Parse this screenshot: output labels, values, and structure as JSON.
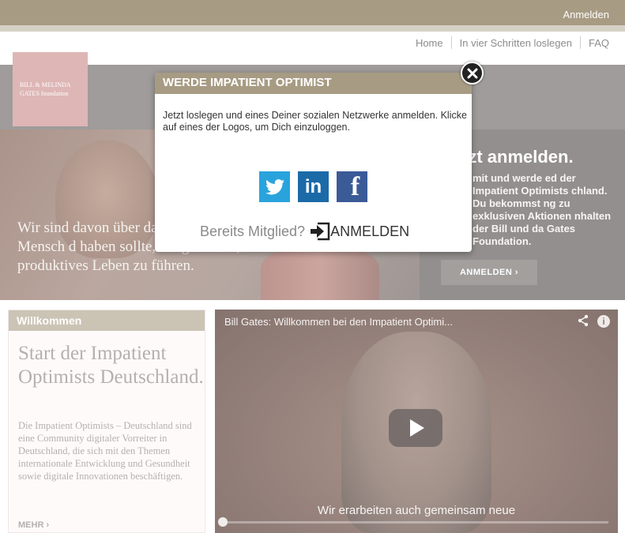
{
  "topbar": {
    "login_label": "Anmelden"
  },
  "nav": {
    "items": [
      "Home",
      "In vier Schritten loslegen",
      "FAQ"
    ]
  },
  "logo": {
    "line1": "BILL & MELINDA",
    "line2": "GATES foundation"
  },
  "hero": {
    "tagline": "Wir sind davon über dass jeder Mensch d haben sollte, ein gesundes, produktives Leben zu führen.",
    "panel_title": "tzt anmelden.",
    "panel_text": "mit und werde ed der Impatient Optimists chland. Du bekommst ng zu exklusiven Aktionen nhalten der Bill und da Gates Foundation.",
    "panel_button": "ANMELDEN ›"
  },
  "welcome": {
    "header": "Willkommen",
    "title": "Start der Impatient Optimists Deutschland.",
    "text": "Die Impatient Optimists – Deutschland sind eine Community digitaler Vorreiter in Deutschland, die sich mit den Themen internationale Entwicklung und Gesundheit sowie digitale Innovationen beschäftigen.",
    "more": "MEHR ›"
  },
  "video": {
    "title": "Bill Gates: Willkommen bei den Impatient Optimi...",
    "caption": "Wir erarbeiten auch gemeinsam neue",
    "progress": 0.0
  },
  "modal": {
    "title": "WERDE IMPATIENT OPTIMIST",
    "text": "Jetzt loslegen und eines Deiner sozialen Netzwerke anmelden. Klicke auf eines der Logos, um Dich einzuloggen.",
    "socials": [
      {
        "name": "twitter-icon",
        "color": "#2aa3dd"
      },
      {
        "name": "linkedin-icon",
        "label": "in",
        "color": "#1b6aa8"
      },
      {
        "name": "facebook-icon",
        "label": "f",
        "color": "#3b5a98"
      }
    ],
    "member_question": "Bereits Mitglied?",
    "login_button": "ANMELDEN"
  },
  "colors": {
    "brand": "#a79b83",
    "logo": "#d29a9a",
    "twitter": "#2aa3dd",
    "linkedin": "#1b6aa8",
    "facebook": "#3b5a98"
  }
}
